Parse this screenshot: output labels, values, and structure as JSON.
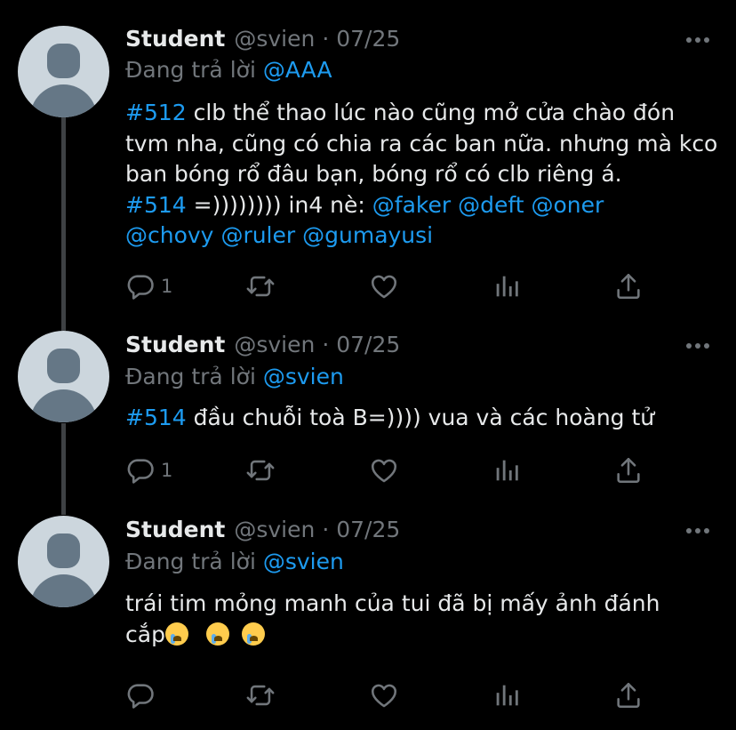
{
  "tweets": [
    {
      "name": "Student",
      "handle": "@svien",
      "separator": "·",
      "date": "07/25",
      "replying_label": "Đang trả lời",
      "replying_to": "@AAA",
      "text": {
        "tag1": "#512",
        "part1": " clb thể thao lúc nào cũng mở cửa chào đón tvm nha, cũng có chia ra các ban nữa. nhưng mà kco ban bóng rổ đâu bạn, bóng rổ có clb riêng á.",
        "tag2": "#514",
        "part2": " =)))))))) in4 nè: ",
        "mentions": [
          "@faker",
          "@deft",
          "@oner",
          "@chovy",
          "@ruler",
          "@gumayusi"
        ]
      },
      "reply_count": "1"
    },
    {
      "name": "Student",
      "handle": "@svien",
      "separator": "·",
      "date": "07/25",
      "replying_label": "Đang trả lời",
      "replying_to": "@svien",
      "text": {
        "tag1": "#514",
        "part1": " đầu chuỗi toà B=)))) vua và các hoàng tử"
      },
      "reply_count": "1"
    },
    {
      "name": "Student",
      "handle": "@svien",
      "separator": "·",
      "date": "07/25",
      "replying_label": "Đang trả lời",
      "replying_to": "@svien",
      "text": {
        "part1": "trái tim mỏng manh của tui đã bị mấy ảnh đánh cắp",
        "emojis": [
          "loudly-crying-face",
          "loudly-crying-face",
          "loudly-crying-face"
        ]
      },
      "reply_count": ""
    }
  ],
  "icons": [
    "reply-icon",
    "retweet-icon",
    "like-icon",
    "analytics-icon",
    "share-icon",
    "more-options-icon"
  ],
  "colors": {
    "background": "#000000",
    "text": "#e7e9ea",
    "secondary": "#71767b",
    "link": "#1d9bf0",
    "thread_line": "#3e4144",
    "avatar_bg": "#ccd6dd",
    "avatar_fg": "#657786"
  }
}
